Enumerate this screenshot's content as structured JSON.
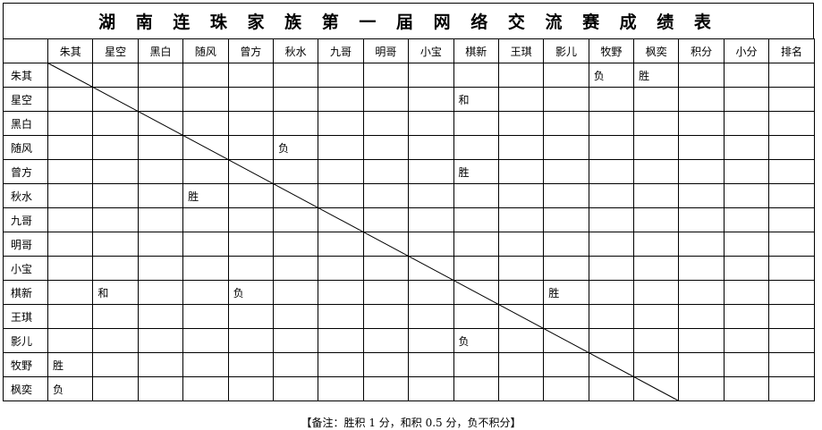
{
  "title": "湖 南 连 珠 家 族 第 一 届 网 络 交 流 赛 成 绩 表",
  "columns": [
    "朱其",
    "星空",
    "黑白",
    "随风",
    "曾方",
    "秋水",
    "九哥",
    "明哥",
    "小宝",
    "棋新",
    "王琪",
    "影儿",
    "牧野",
    "枫奕",
    "积分",
    "小分",
    "排名"
  ],
  "players": [
    "朱其",
    "星空",
    "黑白",
    "随风",
    "曾方",
    "秋水",
    "九哥",
    "明哥",
    "小宝",
    "棋新",
    "王琪",
    "影儿",
    "牧野",
    "枫奕"
  ],
  "results": [
    [
      "",
      "",
      "",
      "",
      "",
      "",
      "",
      "",
      "",
      "",
      "",
      "",
      "负",
      "胜",
      "",
      "",
      ""
    ],
    [
      "",
      "",
      "",
      "",
      "",
      "",
      "",
      "",
      "",
      "和",
      "",
      "",
      "",
      "",
      "",
      "",
      ""
    ],
    [
      "",
      "",
      "",
      "",
      "",
      "",
      "",
      "",
      "",
      "",
      "",
      "",
      "",
      "",
      "",
      "",
      ""
    ],
    [
      "",
      "",
      "",
      "",
      "",
      "负",
      "",
      "",
      "",
      "",
      "",
      "",
      "",
      "",
      "",
      "",
      ""
    ],
    [
      "",
      "",
      "",
      "",
      "",
      "",
      "",
      "",
      "",
      "胜",
      "",
      "",
      "",
      "",
      "",
      "",
      ""
    ],
    [
      "",
      "",
      "",
      "胜",
      "",
      "",
      "",
      "",
      "",
      "",
      "",
      "",
      "",
      "",
      "",
      "",
      ""
    ],
    [
      "",
      "",
      "",
      "",
      "",
      "",
      "",
      "",
      "",
      "",
      "",
      "",
      "",
      "",
      "",
      "",
      ""
    ],
    [
      "",
      "",
      "",
      "",
      "",
      "",
      "",
      "",
      "",
      "",
      "",
      "",
      "",
      "",
      "",
      "",
      ""
    ],
    [
      "",
      "",
      "",
      "",
      "",
      "",
      "",
      "",
      "",
      "",
      "",
      "",
      "",
      "",
      "",
      "",
      ""
    ],
    [
      "",
      "和",
      "",
      "",
      "负",
      "",
      "",
      "",
      "",
      "",
      "",
      "胜",
      "",
      "",
      "",
      "",
      ""
    ],
    [
      "",
      "",
      "",
      "",
      "",
      "",
      "",
      "",
      "",
      "",
      "",
      "",
      "",
      "",
      "",
      "",
      ""
    ],
    [
      "",
      "",
      "",
      "",
      "",
      "",
      "",
      "",
      "",
      "负",
      "",
      "",
      "",
      "",
      "",
      "",
      ""
    ],
    [
      "胜",
      "",
      "",
      "",
      "",
      "",
      "",
      "",
      "",
      "",
      "",
      "",
      "",
      "",
      "",
      "",
      ""
    ],
    [
      "负",
      "",
      "",
      "",
      "",
      "",
      "",
      "",
      "",
      "",
      "",
      "",
      "",
      "",
      "",
      "",
      ""
    ]
  ],
  "note": "【备注：胜积 1 分，和积 0.5 分，负不积分】"
}
